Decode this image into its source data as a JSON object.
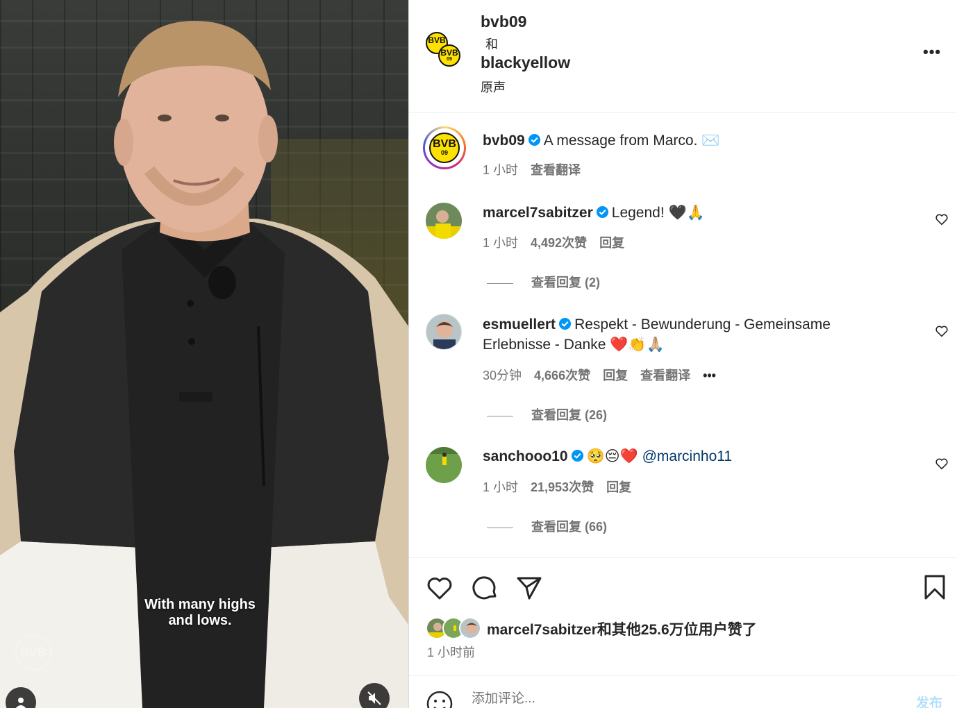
{
  "video": {
    "subtitle_line1": "With many highs",
    "subtitle_line2": "and lows.",
    "watermark": "BVB",
    "mute_icon": "speaker-muted-icon",
    "user_icon": "person-icon"
  },
  "header": {
    "account1": "bvb09",
    "joiner": "和",
    "account2": "blackyellow",
    "audio": "原声",
    "logo_text": "BVB",
    "logo_year": "09"
  },
  "caption": {
    "username": "bvb09",
    "text": "A message from Marco. ✉️",
    "time": "1 小时",
    "translate": "查看翻译"
  },
  "comments": [
    {
      "username": "marcel7sabitzer",
      "text": "Legend! 🖤🙏",
      "time": "1 小时",
      "likes": "4,492次赞",
      "reply": "回复",
      "view_replies": "查看回复 (2)"
    },
    {
      "username": "esmuellert",
      "text_line1": "Respekt - Bewunderung - Gemeinsame",
      "text_line2": "Erlebnisse - Danke ❤️👏🙏🏼",
      "time": "30分钟",
      "likes": "4,666次赞",
      "reply": "回复",
      "translate": "查看翻译",
      "more": "•••",
      "view_replies": "查看回复 (26)"
    },
    {
      "username": "sanchooo10",
      "text": "🥺😔❤️",
      "mention": "@marcinho11",
      "time": "1 小时",
      "likes": "21,953次赞",
      "reply": "回复",
      "view_replies": "查看回复 (66)"
    }
  ],
  "actions": {
    "liked_by_user": "marcel7sabitzer",
    "liked_by_rest": "和其他25.6万位用户赞了",
    "time_ago": "1 小时前"
  },
  "comment_box": {
    "placeholder": "添加评论...",
    "post": "发布"
  },
  "colors": {
    "verified": "#0095f6",
    "bvb_yellow": "#fde100",
    "text": "#262626",
    "secondary": "#737373",
    "link": "#00376b"
  }
}
